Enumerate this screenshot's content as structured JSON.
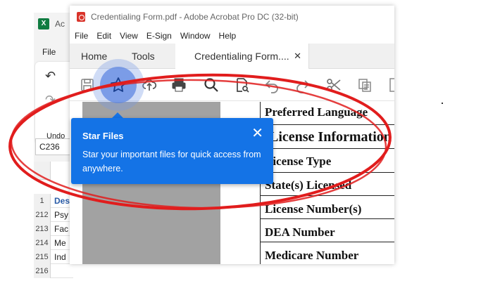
{
  "excel": {
    "logo": "X",
    "app_name": "Ac",
    "file_menu": "File",
    "undo_label": "Undo",
    "name_box": "C236",
    "rows": [
      {
        "num": "1",
        "text": "Des",
        "head": true
      },
      {
        "num": "212",
        "text": "Psy"
      },
      {
        "num": "213",
        "text": "Fac"
      },
      {
        "num": "214",
        "text": "Me"
      },
      {
        "num": "215",
        "text": "Ind"
      },
      {
        "num": "216",
        "text": ""
      }
    ]
  },
  "acrobat": {
    "title": "Credentialing Form.pdf - Adobe Acrobat Pro DC (32-bit)",
    "menu": [
      "File",
      "Edit",
      "View",
      "E-Sign",
      "Window",
      "Help"
    ],
    "tabs": {
      "home": "Home",
      "tools": "Tools",
      "document": "Credentialing Form....",
      "close": "✕"
    },
    "toolbar_icons": [
      "save-icon",
      "star-icon",
      "upload-icon",
      "print-icon",
      "search-icon",
      "file-search-icon",
      "undo-icon",
      "redo-icon",
      "scissors-icon",
      "copy-icon",
      "page-icon"
    ],
    "form_rows": [
      "Preferred Language",
      "License Information",
      "License Type",
      "State(s) Licensed",
      "License Number(s)",
      "DEA Number",
      "Medicare Number"
    ]
  },
  "popup": {
    "title": "Star Files",
    "text": "Star your important files for quick access from anywhere.",
    "close": "✕"
  },
  "colors": {
    "popup_bg": "#1473e6",
    "annotation": "#e11d1d",
    "excel_green": "#107c41",
    "pdf_red": "#d9342b"
  }
}
